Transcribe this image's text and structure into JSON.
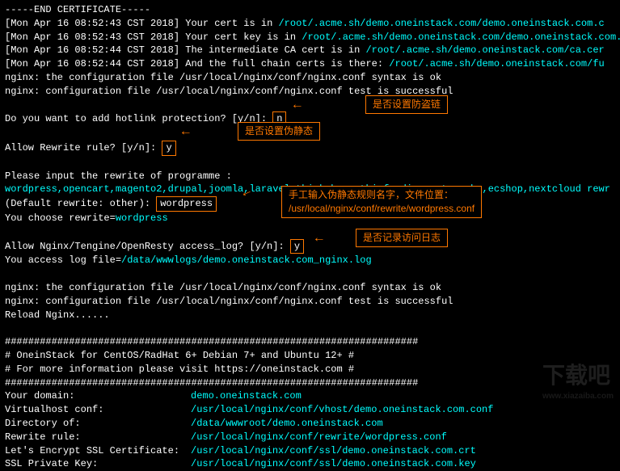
{
  "term": {
    "endcert": "-----END CERTIFICATE-----",
    "ts1": "[Mon Apr 16 08:52:43 CST 2018]",
    "ts2": "[Mon Apr 16 08:52:44 CST 2018]",
    "cert_in": " Your cert is in  ",
    "cert_path": "/root/.acme.sh/demo.oneinstack.com/demo.oneinstack.com.c",
    "key_in": " Your cert key is in  ",
    "key_path": "/root/.acme.sh/demo.oneinstack.com/demo.oneinstack.com.k",
    "ca_in": " The intermediate CA cert is in  ",
    "ca_path": "/root/.acme.sh/demo.oneinstack.com/ca.cer",
    "full_in": " And the full chain certs is there:  ",
    "full_path": "/root/.acme.sh/demo.oneinstack.com/fu",
    "nginx_ok": "nginx: the configuration file /usr/local/nginx/conf/nginx.conf syntax is ok",
    "nginx_success": "nginx: configuration file /usr/local/nginx/conf/nginx.conf test is successful",
    "hotlink_q": "Do you want to add hotlink protection? [y/n]: ",
    "hotlink_a": "n",
    "rewrite_q": "Allow Rewrite rule? [y/n]: ",
    "rewrite_a": "y",
    "rewrite_prompt": "Please input the rewrite of programme :",
    "rewrite_list": "wordpress,opencart,magento2,drupal,joomla,laravel,thinkphp,pathinfo,discuz,typecho,ecshop,nextcloud rewr",
    "default_rewrite": "(Default rewrite: other): ",
    "default_rewrite_a": "wordpress",
    "choose_rewrite": "You choose rewrite=",
    "choose_rewrite_v": "wordpress",
    "accesslog_q": "Allow Nginx/Tengine/OpenResty access_log? [y/n]: ",
    "accesslog_a": "y",
    "accesslog_file": "You access log file=",
    "accesslog_path": "/data/wwwlogs/demo.oneinstack.com_nginx.log",
    "reload": "Reload Nginx......",
    "hashline": "#######################################################################",
    "banner1": "#       OneinStack for CentOS/RadHat 6+ Debian 7+ and Ubuntu 12+      #",
    "banner2": "#       For more information please visit https://oneinstack.com      #"
  },
  "summary": {
    "domain_lbl": "Your domain:",
    "domain_val": "demo.oneinstack.com",
    "vhost_lbl": "Virtualhost conf:",
    "vhost_val": "/usr/local/nginx/conf/vhost/demo.oneinstack.com.conf",
    "dir_lbl": "Directory of:",
    "dir_val": "/data/wwwroot/demo.oneinstack.com",
    "rewrite_lbl": "Rewrite rule:",
    "rewrite_val": "/usr/local/nginx/conf/rewrite/wordpress.conf",
    "ssl_lbl": "Let's Encrypt SSL Certificate:",
    "ssl_val": "/usr/local/nginx/conf/ssl/demo.oneinstack.com.crt",
    "sslkey_lbl": "SSL Private Key:",
    "sslkey_val": "/usr/local/nginx/conf/ssl/demo.oneinstack.com.key"
  },
  "callouts": {
    "hotlink": "是否设置防盗链",
    "rewrite": "是否设置伪静态",
    "manual1": "手工输入伪静态规则名字，文件位置：",
    "manual2": "/usr/local/nginx/conf/rewrite/wordpress.conf",
    "accesslog": "是否记录访问日志"
  },
  "watermark": {
    "main": "下载吧",
    "sub": "www.xiazaiba.com"
  }
}
